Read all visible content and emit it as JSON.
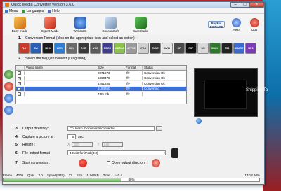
{
  "window": {
    "title": "Quick Media Converter  Version 3.6.0"
  },
  "menu": {
    "items": [
      "Menu",
      "Languages",
      "Help"
    ]
  },
  "toolbar": {
    "buttons": [
      "Easy mode",
      "Expert Mode",
      "WebCam",
      "CocoonSoft",
      "CamStudio"
    ],
    "paypal_label": "PayPal DONATE",
    "help_label": "Help",
    "quit_label": "Quit"
  },
  "step1": {
    "num": "1.",
    "label": "Conversion Format (click on the appropriate icon and select an option) :"
  },
  "formats": [
    "FLV",
    "AVI",
    "MP4",
    "WMV",
    "MOV",
    "DVD",
    "VCD",
    "MPEG",
    "ANDROID",
    "APPLE",
    "iPOD",
    "ZUNE",
    "XVID",
    "GP",
    "PSP",
    "WII",
    "XBOX",
    "PS3",
    "SMART",
    "MP3"
  ],
  "step2": {
    "num": "2.",
    "label": "Select the file(s) to convert (Drag/Drag)"
  },
  "files": {
    "headers": [
      "Video name",
      "Size",
      "Format",
      "Status"
    ],
    "rows": [
      {
        "name": "",
        "size": "8071673",
        "format": ".flv",
        "status": "Conversion Ok",
        "checked": true,
        "selected": false
      },
      {
        "name": "",
        "size": "5360475",
        "format": ".flv",
        "status": "Conversion Ok",
        "checked": true,
        "selected": false
      },
      {
        "name": "",
        "size": "4251835",
        "format": ".flv",
        "status": "Conversion Ok",
        "checked": true,
        "selected": false
      },
      {
        "name": "",
        "size": "9183860",
        "format": ".flv",
        "status": "Converting",
        "checked": true,
        "selected": true
      },
      {
        "name": "",
        "size": "7.95 mb",
        "format": ".flv",
        "status": "",
        "checked": true,
        "selected": false
      }
    ]
  },
  "snip_text": "Snipping To",
  "step3": {
    "num": "3.",
    "label": "Output directory :",
    "value": "C:\\Users\\          \\Documents\\converted",
    "btn": "..."
  },
  "step4": {
    "num": "4.",
    "label": "Capture a picture at :",
    "value": "5",
    "unit": "sec"
  },
  "step5": {
    "num": "5.",
    "label": "Resize :",
    "x_label": "X",
    "x_value": "320",
    "y_label": "Y",
    "y_value": "240"
  },
  "step6": {
    "num": "6.",
    "label": "File output format",
    "value": "4 XviD for iPod (4:3)"
  },
  "step7": {
    "num": "7.",
    "label": "Start conversion :",
    "open_label": "Open output directory :"
  },
  "status": {
    "frame_label": "Frame",
    "frame": "4209",
    "qual_label": "Qual",
    "qual": "3.0",
    "speed_label": "Speed(FPS)",
    "speed": "22",
    "size_label": "Size",
    "size": "11569kB",
    "time_label": "Time",
    "time": "140.4",
    "count": "17/18  94%"
  },
  "progress": {
    "text": "46%",
    "value": 0.46
  }
}
